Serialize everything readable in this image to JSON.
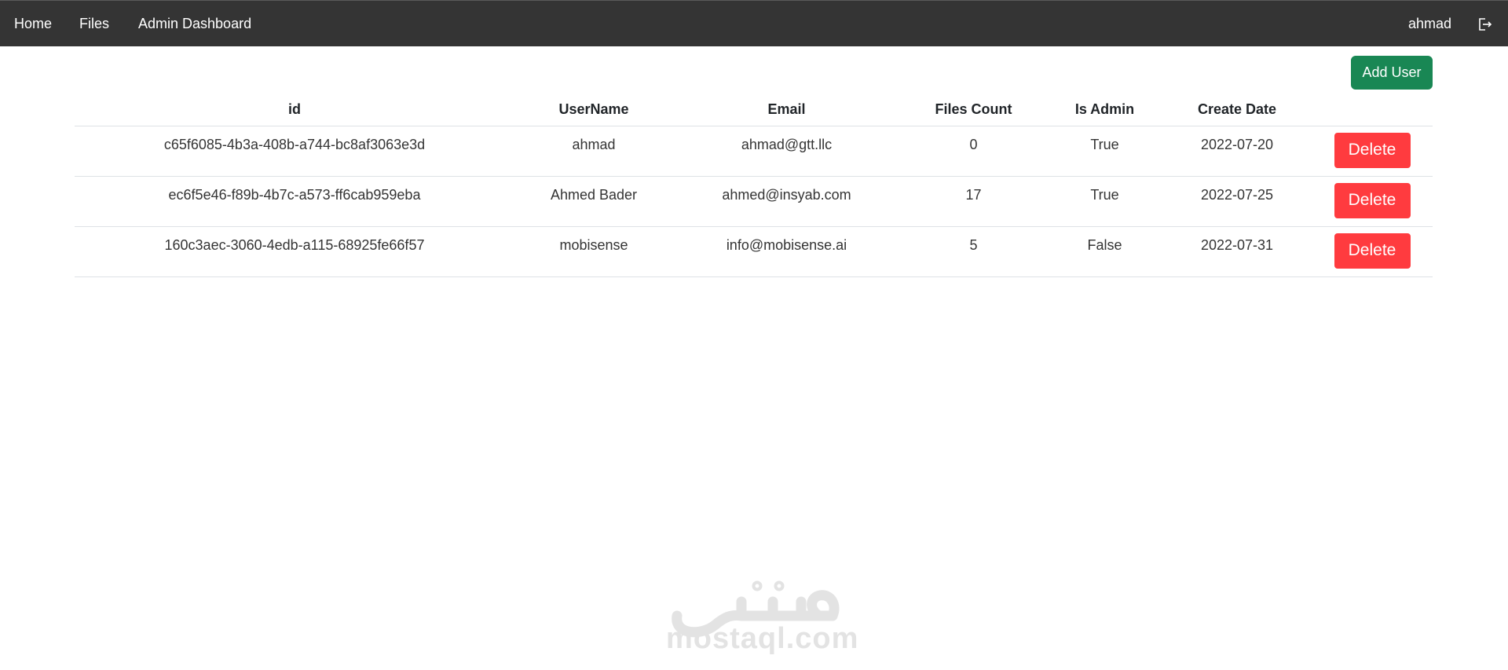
{
  "navbar": {
    "home": "Home",
    "files": "Files",
    "admin_dashboard": "Admin Dashboard",
    "user": "ahmad",
    "logout_icon": "logout-icon"
  },
  "toolbar": {
    "add_user_label": "Add User"
  },
  "table": {
    "headers": [
      "id",
      "UserName",
      "Email",
      "Files Count",
      "Is Admin",
      "Create Date",
      ""
    ],
    "rows": [
      {
        "id": "c65f6085-4b3a-408b-a744-bc8af3063e3d",
        "username": "ahmad",
        "email": "ahmad@gtt.llc",
        "files_count": "0",
        "is_admin": "True",
        "create_date": "2022-07-20",
        "delete_label": "Delete"
      },
      {
        "id": "ec6f5e46-f89b-4b7c-a573-ff6cab959eba",
        "username": "Ahmed Bader",
        "email": "ahmed@insyab.com",
        "files_count": "17",
        "is_admin": "True",
        "create_date": "2022-07-25",
        "delete_label": "Delete"
      },
      {
        "id": "160c3aec-3060-4edb-a115-68925fe66f57",
        "username": "mobisense",
        "email": "info@mobisense.ai",
        "files_count": "5",
        "is_admin": "False",
        "create_date": "2022-07-31",
        "delete_label": "Delete"
      }
    ]
  },
  "watermark": {
    "text": "mostaql.com"
  },
  "colors": {
    "navbar_bg": "#343434",
    "add_user_bg": "#198754",
    "delete_bg": "#ff3b3f",
    "watermark": "#e3e3e3"
  }
}
